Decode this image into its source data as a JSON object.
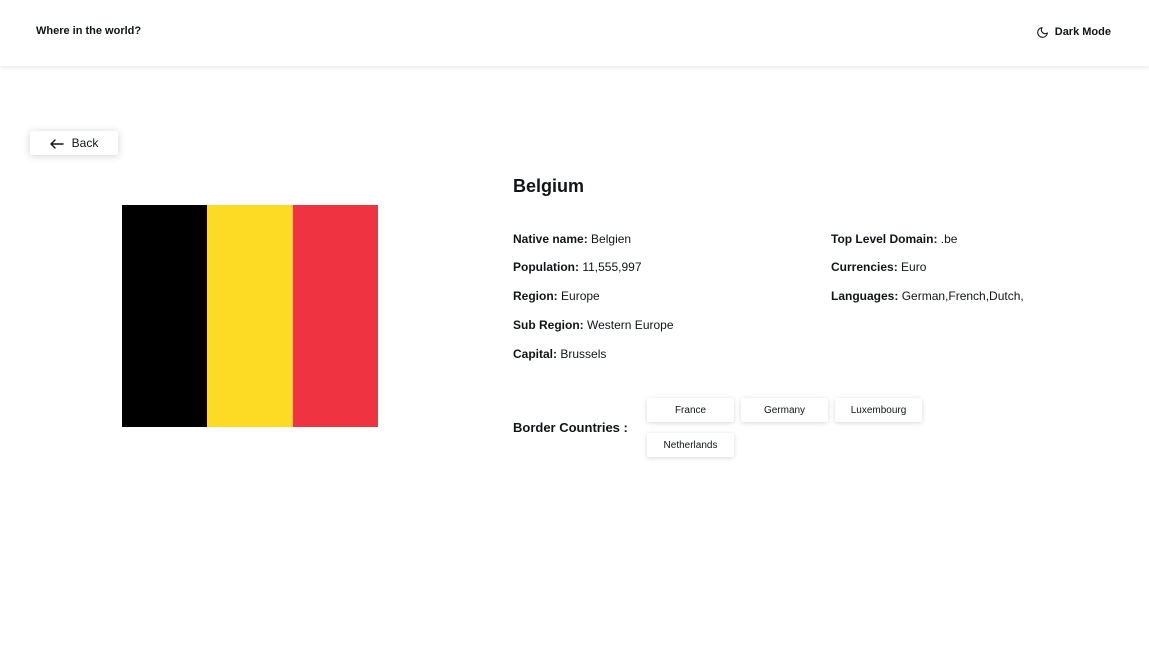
{
  "header": {
    "title": "Where in the world?",
    "dark_mode_label": "Dark Mode",
    "dark_mode_icon": "moon-icon"
  },
  "back_button": {
    "label": "Back",
    "icon": "arrow-left-icon"
  },
  "country": {
    "name": "Belgium",
    "flag_colors": [
      "#000000",
      "#FDDA24",
      "#EF3340"
    ],
    "left_column": [
      {
        "label": "Native name:",
        "value": "Belgien"
      },
      {
        "label": "Population:",
        "value": "11,555,997"
      },
      {
        "label": "Region:",
        "value": "Europe"
      },
      {
        "label": "Sub Region:",
        "value": "Western Europe"
      },
      {
        "label": "Capital:",
        "value": "Brussels"
      }
    ],
    "right_column": [
      {
        "label": "Top Level Domain:",
        "value": ".be"
      },
      {
        "label": "Currencies:",
        "value": "Euro"
      },
      {
        "label": "Languages:",
        "value": "German,French,Dutch,"
      }
    ],
    "border_label": "Border Countries :",
    "border_countries": [
      "France",
      "Germany",
      "Luxembourg",
      "Netherlands"
    ]
  }
}
